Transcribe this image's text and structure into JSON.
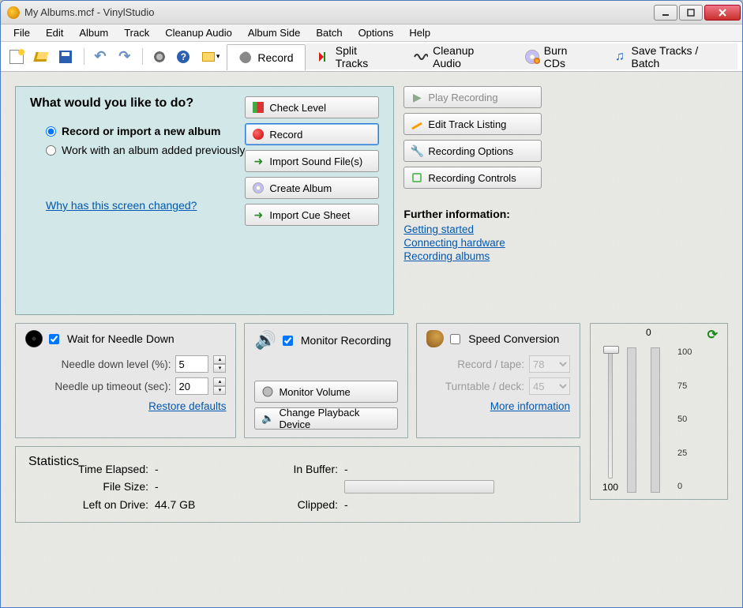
{
  "window": {
    "title": "My Albums.mcf - VinylStudio"
  },
  "menus": [
    "File",
    "Edit",
    "Album",
    "Track",
    "Cleanup Audio",
    "Album Side",
    "Batch",
    "Options",
    "Help"
  ],
  "tabs": {
    "record": "Record",
    "split": "Split Tracks",
    "cleanup": "Cleanup Audio",
    "burn": "Burn CDs",
    "save": "Save Tracks / Batch"
  },
  "main": {
    "heading": "What would you like to do?",
    "opt1": "Record or import a new album",
    "opt2": "Work with an album added previously",
    "whylink": "Why has this screen changed?"
  },
  "actions": {
    "checklevel": "Check Level",
    "record": "Record",
    "importsound": "Import Sound File(s)",
    "createalbum": "Create Album",
    "importcue": "Import Cue Sheet"
  },
  "side": {
    "play": "Play Recording",
    "edit": "Edit Track Listing",
    "recopts": "Recording Options",
    "recctrl": "Recording Controls"
  },
  "further": {
    "title": "Further information:",
    "l1": "Getting started",
    "l2": "Connecting hardware",
    "l3": "Recording albums"
  },
  "needle": {
    "wait": "Wait for Needle Down",
    "level_lbl": "Needle down level (%):",
    "level_val": "5",
    "timeout_lbl": "Needle up timeout (sec):",
    "timeout_val": "20",
    "restore": "Restore defaults"
  },
  "monitor": {
    "chk": "Monitor Recording",
    "vol": "Monitor Volume",
    "dev": "Change Playback Device"
  },
  "speed": {
    "chk": "Speed Conversion",
    "rec_lbl": "Record / tape:",
    "rec_val": "78",
    "tt_lbl": "Turntable / deck:",
    "tt_val": "45",
    "more": "More information"
  },
  "stats": {
    "legend": "Statistics",
    "elapsed_lbl": "Time Elapsed:",
    "elapsed_val": "-",
    "buffer_lbl": "In Buffer:",
    "buffer_val": "-",
    "size_lbl": "File Size:",
    "size_val": "-",
    "left_lbl": "Left on Drive:",
    "left_val": "44.7 GB",
    "clip_lbl": "Clipped:",
    "clip_val": "-"
  },
  "meter": {
    "top_left": "0",
    "slider_bottom": "100",
    "ticks": [
      "100",
      "75",
      "50",
      "25",
      "0"
    ]
  }
}
